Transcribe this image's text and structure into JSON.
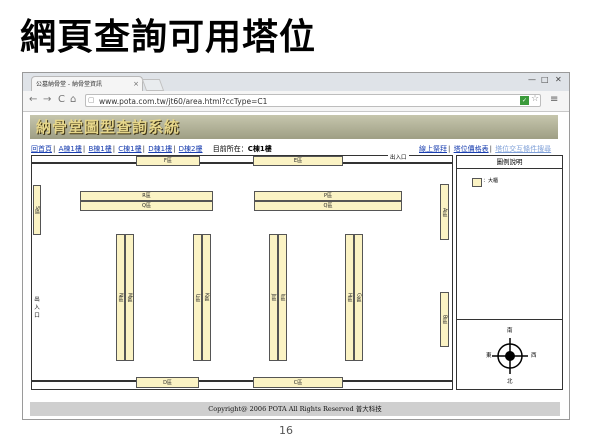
{
  "slide": {
    "title": "網頁查詢可用塔位",
    "page_number": "16"
  },
  "browser": {
    "tab_title": "公墓納骨堂 - 納骨堂資訊",
    "tab_close": "×",
    "url": "www.pota.com.tw/jt60/area.html?ccType=C1",
    "nav": {
      "back": "←",
      "forward": "→",
      "reload": "C",
      "home": "⌂"
    },
    "icons": {
      "star": "☆",
      "menu": "≡",
      "shield": "✓",
      "page": "▢"
    },
    "window_controls": {
      "minimize": "—",
      "maximize": "□",
      "close": "✕"
    }
  },
  "site": {
    "banner_title": "納骨堂圖型查詢系統",
    "nav_links": [
      "回首頁",
      "A棟1樓",
      "B棟1樓",
      "C棟1樓",
      "D棟1樓",
      "D棟2樓"
    ],
    "current_location_label": "目前所在：",
    "current_location_value": "C棟1樓",
    "right_links": [
      "線上祭拜",
      "塔位價格表",
      "塔位交互條件搜尋"
    ],
    "separator": "|"
  },
  "map": {
    "exit_top": "出入口",
    "exit_left": [
      "出",
      "入",
      "口"
    ],
    "zones": {
      "F": "F區",
      "E": "E區",
      "R": "R區",
      "P": "P區",
      "Q1": "Q區",
      "Q2": "Q區",
      "S": "S區",
      "A": "A區",
      "B": "B區",
      "N": "N區",
      "M": "M區",
      "L": "L區",
      "K": "K區",
      "J": "J區",
      "I": "I區",
      "H": "H區",
      "G": "G區",
      "D": "D區",
      "C": "C區"
    }
  },
  "legend": {
    "title": "圖例說明",
    "items": [
      {
        "label": "：大櫃",
        "color": "#fbf3c4"
      }
    ],
    "compass": {
      "north": "北",
      "south": "南",
      "east": "東",
      "west": "西"
    }
  },
  "footer": {
    "text": "Copyright@  2006  POTA  All  Rights  Reserved    普大科技"
  }
}
